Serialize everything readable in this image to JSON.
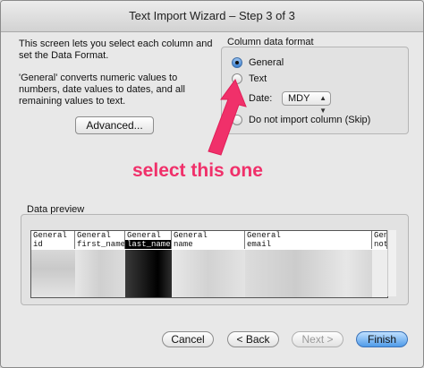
{
  "window": {
    "title": "Text Import Wizard – Step 3 of 3"
  },
  "intro": {
    "p1": "This screen lets you select each column and set the Data Format.",
    "p2": "'General' converts numeric values to numbers, date values to dates, and all remaining values to text."
  },
  "advanced_label": "Advanced...",
  "format": {
    "title": "Column data format",
    "general": "General",
    "text": "Text",
    "date": "Date:",
    "date_value": "MDY",
    "skip": "Do not import column (Skip)",
    "selected": "general"
  },
  "annotation": {
    "text": "select this one",
    "color": "#f0306a"
  },
  "preview": {
    "title": "Data preview",
    "format_row": [
      "General",
      "General",
      "General",
      "General",
      "General",
      "Gen"
    ],
    "header_row": [
      "id",
      "first_name",
      "last_name",
      "name",
      "email",
      "not"
    ],
    "selected_column": 2
  },
  "buttons": {
    "cancel": "Cancel",
    "back": "< Back",
    "next": "Next >",
    "finish": "Finish"
  },
  "colors": {
    "accent": "#4f9be8",
    "annotation": "#f0306a"
  }
}
